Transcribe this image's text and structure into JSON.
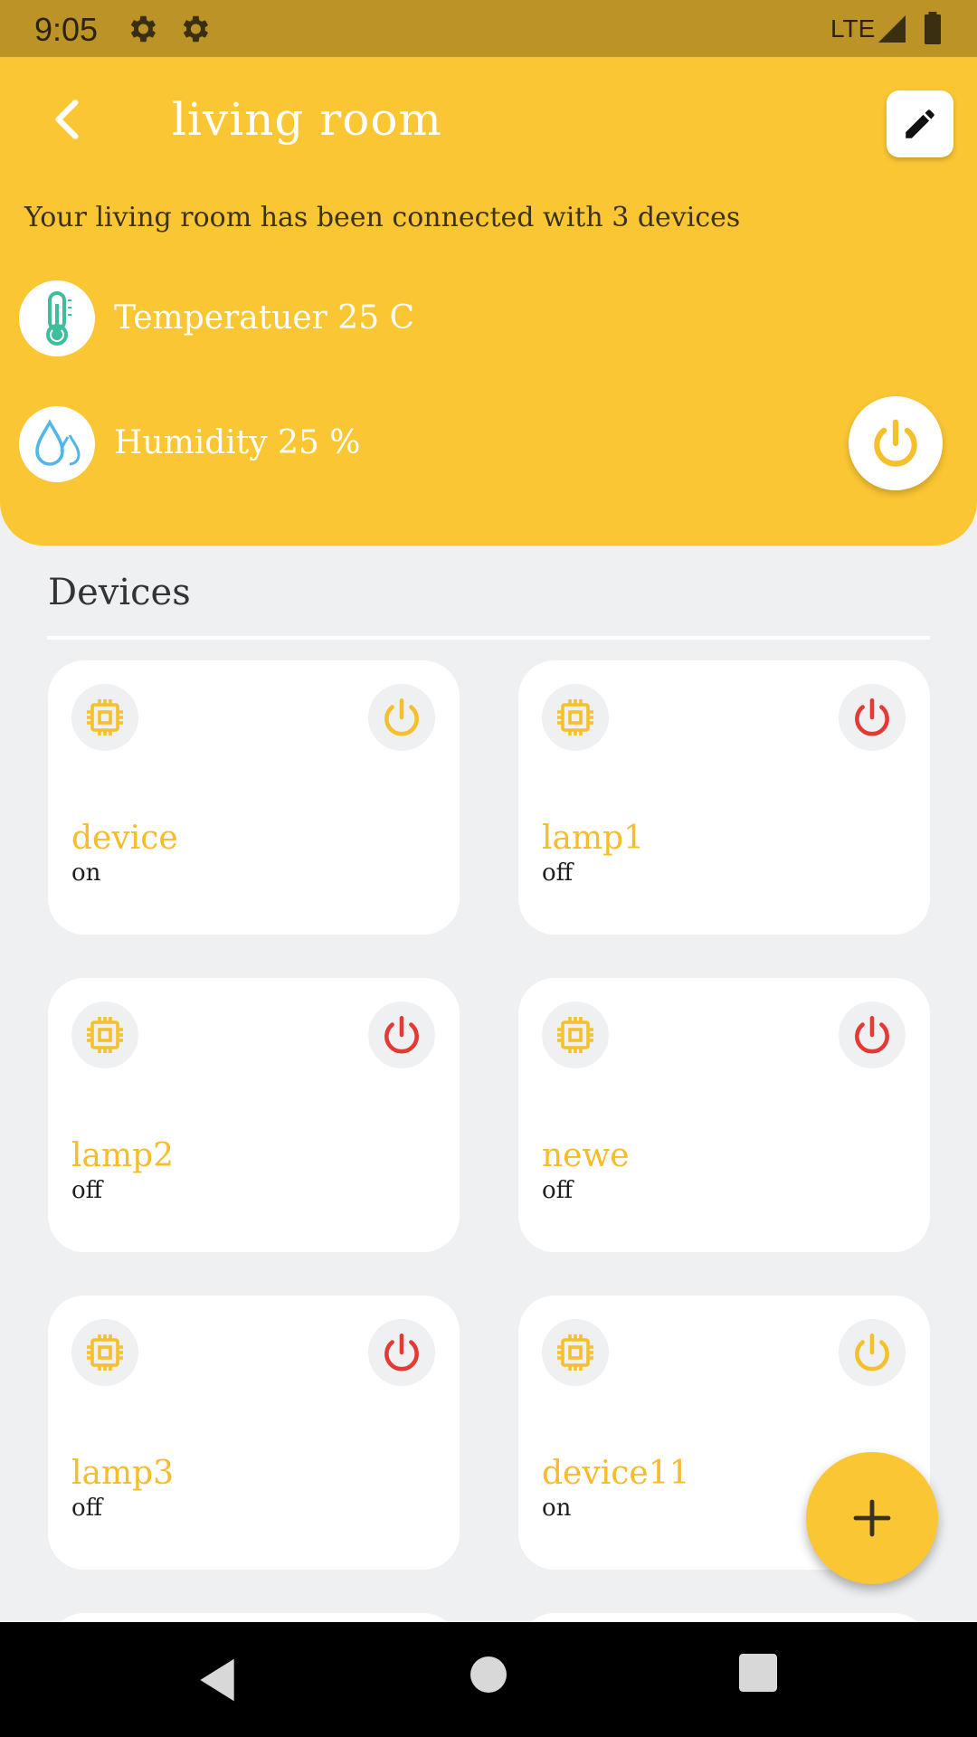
{
  "status_bar": {
    "time": "9:05",
    "network": "LTE",
    "icons": [
      "gear-icon",
      "gear-icon",
      "signal-icon",
      "battery-icon"
    ]
  },
  "header": {
    "title": "living room",
    "description": "Your living room has been connected with 3 devices",
    "temperature_label": "Temperatuer 25 C",
    "humidity_label": "Humidity 25 %",
    "background": "#FBC634"
  },
  "devices_section": {
    "heading": "Devices"
  },
  "devices": [
    {
      "name": "device",
      "status": "on"
    },
    {
      "name": "lamp1",
      "status": "off"
    },
    {
      "name": "lamp2",
      "status": "off"
    },
    {
      "name": "newe",
      "status": "off"
    },
    {
      "name": "lamp3",
      "status": "off"
    },
    {
      "name": "device11",
      "status": "on"
    }
  ],
  "colors": {
    "accent": "#FBC634",
    "on": "#F6C02C",
    "off": "#E53935",
    "device_name": "#F8BB29"
  }
}
